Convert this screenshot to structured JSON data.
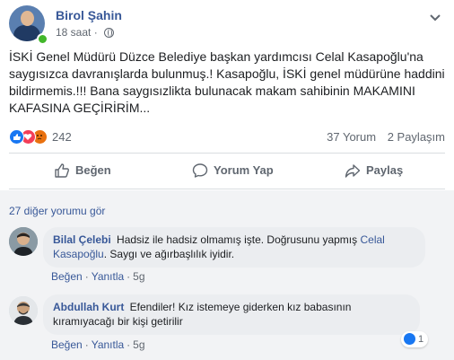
{
  "post": {
    "author": "Birol Şahin",
    "time": "18 saat",
    "text": "İSKİ Genel Müdürü Düzce Belediye başkan yardımcısı Celal Kasapoğlu'na saygısızca davranışlarda bulunmuş.! Kasapoğlu, İSKİ genel müdürüne haddini bildirmemis.!!! Bana saygısızlikta bulunacak makam sahibinin MAKAMINI KAFASINA GEÇİRİRİM...",
    "reaction_count": "242",
    "comment_count": "37 Yorum",
    "share_count": "2 Paylaşım"
  },
  "actions": {
    "like": "Beğen",
    "comment": "Yorum Yap",
    "share": "Paylaş"
  },
  "more_comments": "27 diğer yorumu gör",
  "comments": [
    {
      "author": "Bilal Çelebi",
      "text_before": "Hadsiz ile hadsiz olmamış işte. Doğrusunu yapmış ",
      "mention": "Celal Kasapoğlu",
      "text_after": ". Saygı ve ağırbaşlılık iyidir.",
      "like": "Beğen",
      "reply": "Yanıtla",
      "time": "5g"
    },
    {
      "author": "Abdullah Kurt",
      "text": "Efendiler! Kız istemeye giderken kız babasının kıramıyacağı bir kişi getirilir",
      "like": "Beğen",
      "reply": "Yanıtla",
      "time": "5g",
      "reaction_count": "1"
    }
  ],
  "colors": {
    "link": "#385898",
    "secondary": "#606770",
    "like_blue": "#1877f2",
    "love_red": "#f33e58",
    "angry_orange": "#e9710f",
    "online_green": "#42b72a"
  }
}
